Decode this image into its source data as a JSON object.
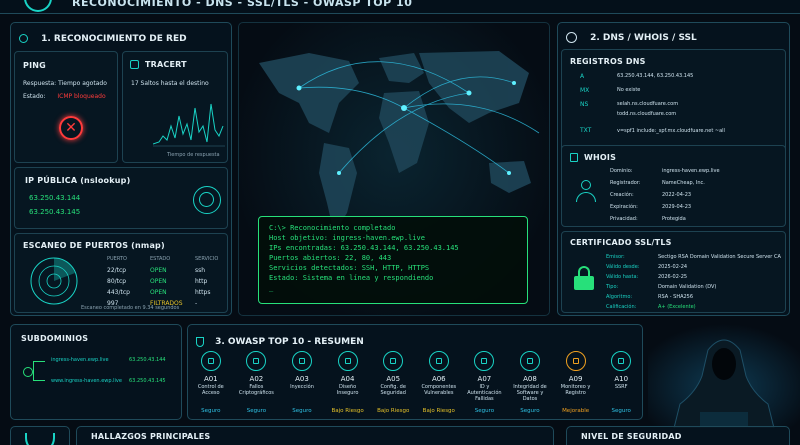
{
  "header": {
    "title": "RECONOCIMIENTO - DNS - SSL/TLS - OWASP TOP 10"
  },
  "recon": {
    "title": "1. RECONOCIMIENTO DE RED",
    "ping": {
      "title": "PING",
      "response_label": "Respuesta:",
      "response_value": "Tiempo agotado",
      "status_label": "Estado:",
      "status_value": "ICMP bloqueado"
    },
    "tracert": {
      "title": "TRACERT",
      "hops": "17 Saltos hasta el destino",
      "caption": "Tiempo de respuesta"
    },
    "public_ip": {
      "title": "IP PÚBLICA (nslookup)",
      "ips": [
        "63.250.43.144",
        "63.250.43.145"
      ]
    },
    "ports": {
      "title": "ESCANEO DE PUERTOS (nmap)",
      "headers": [
        "PUERTO",
        "ESTADO",
        "SERVICIO"
      ],
      "rows": [
        {
          "port": "22/tcp",
          "state": "OPEN",
          "service": "ssh"
        },
        {
          "port": "80/tcp",
          "state": "OPEN",
          "service": "http"
        },
        {
          "port": "443/tcp",
          "state": "OPEN",
          "service": "https"
        },
        {
          "port": "997",
          "state": "FILTRADOS",
          "service": "-"
        }
      ],
      "footer": "Escaneo completado en 9.34 segundos"
    }
  },
  "terminal": {
    "lines": [
      "C:\\> Reconocimiento completado",
      "Host objetivo: ingress-haven.ewp.live",
      "IPs encontradas: 63.250.43.144, 63.250.43.145",
      "Puertos abiertos: 22, 80, 443",
      "Servicios detectados: SSH, HTTP, HTTPS",
      "Estado: Sistema en línea y respondiendo",
      "_"
    ]
  },
  "dns": {
    "title": "2. DNS / WHOIS / SSL",
    "records_title": "REGISTROS DNS",
    "records": [
      {
        "type": "A",
        "value": "63.250.43.144, 63.250.43.145"
      },
      {
        "type": "MX",
        "value": "No existe"
      },
      {
        "type": "NS",
        "value": "selah.ns.cloudfuare.com"
      },
      {
        "type": "",
        "value": "todd.ns.cloudfuare.com"
      },
      {
        "type": "TXT",
        "value": "v=spf1 include:_spf.mx.cloudfuare.net ~all"
      }
    ]
  },
  "whois": {
    "title": "WHOIS",
    "rows": [
      {
        "label": "Dominio:",
        "value": "ingress-haven.ewp.live"
      },
      {
        "label": "Registrador:",
        "value": "NameCheap, Inc."
      },
      {
        "label": "Creación:",
        "value": "2022-04-23"
      },
      {
        "label": "Expiración:",
        "value": "2029-04-23"
      },
      {
        "label": "Privacidad:",
        "value": "Protegida"
      }
    ]
  },
  "ssl": {
    "title": "CERTIFICADO SSL/TLS",
    "rows": [
      {
        "label": "Emisor:",
        "value": "Sectigo RSA Domain Validation Secure Server CA"
      },
      {
        "label": "Válido desde:",
        "value": "2025-02-24"
      },
      {
        "label": "Válido hasta:",
        "value": "2026-02-25"
      },
      {
        "label": "Tipo:",
        "value": "Domain Validation (DV)"
      },
      {
        "label": "Algoritmo:",
        "value": "RSA - SHA256"
      },
      {
        "label": "Calificación:",
        "value": "A+ (Excelente)"
      }
    ]
  },
  "subdomains": {
    "title": "SUBDOMINIOS",
    "items": [
      {
        "host": "ingress-haven.ewp.live",
        "ip": "63.250.43.144"
      },
      {
        "host": "www.ingress-haven.ewp.live",
        "ip": "63.250.43.145"
      }
    ]
  },
  "owasp": {
    "title": "3. OWASP TOP 10 - RESUMEN",
    "items": [
      {
        "code": "A01",
        "name": "Control de Acceso",
        "status": "Seguro",
        "icon": "lock-icon"
      },
      {
        "code": "A02",
        "name": "Fallos Criptográficos",
        "status": "Seguro",
        "icon": "key-icon"
      },
      {
        "code": "A03",
        "name": "Inyección",
        "status": "Seguro",
        "icon": "syringe-icon"
      },
      {
        "code": "A04",
        "name": "Diseño Inseguro",
        "status": "Bajo Riesgo",
        "icon": "design-icon"
      },
      {
        "code": "A05",
        "name": "Config. de Seguridad",
        "status": "Bajo Riesgo",
        "icon": "gear-icon"
      },
      {
        "code": "A06",
        "name": "Componentes Vulnerables",
        "status": "Bajo Riesgo",
        "icon": "components-icon"
      },
      {
        "code": "A07",
        "name": "ID y Autenticación Fallidas",
        "status": "Seguro",
        "icon": "user-icon"
      },
      {
        "code": "A08",
        "name": "Integridad de Software y Datos",
        "status": "Seguro",
        "icon": "shield-check-icon"
      },
      {
        "code": "A09",
        "name": "Monitoreo y Registro",
        "status": "Mejorable",
        "icon": "monitor-icon"
      },
      {
        "code": "A10",
        "name": "SSRF",
        "status": "Seguro",
        "icon": "server-icon"
      }
    ]
  },
  "bottom": {
    "findings_title": "HALLAZGOS PRINCIPALES",
    "level_title": "NIVEL DE SEGURIDAD"
  },
  "colors": {
    "teal": "#19d3c5",
    "green": "#27e07a",
    "red": "#ff3b3b",
    "yellow": "#e6c229",
    "safe": "#2fc3e6",
    "low_risk": "#e6c229",
    "improve": "#f0a020"
  }
}
